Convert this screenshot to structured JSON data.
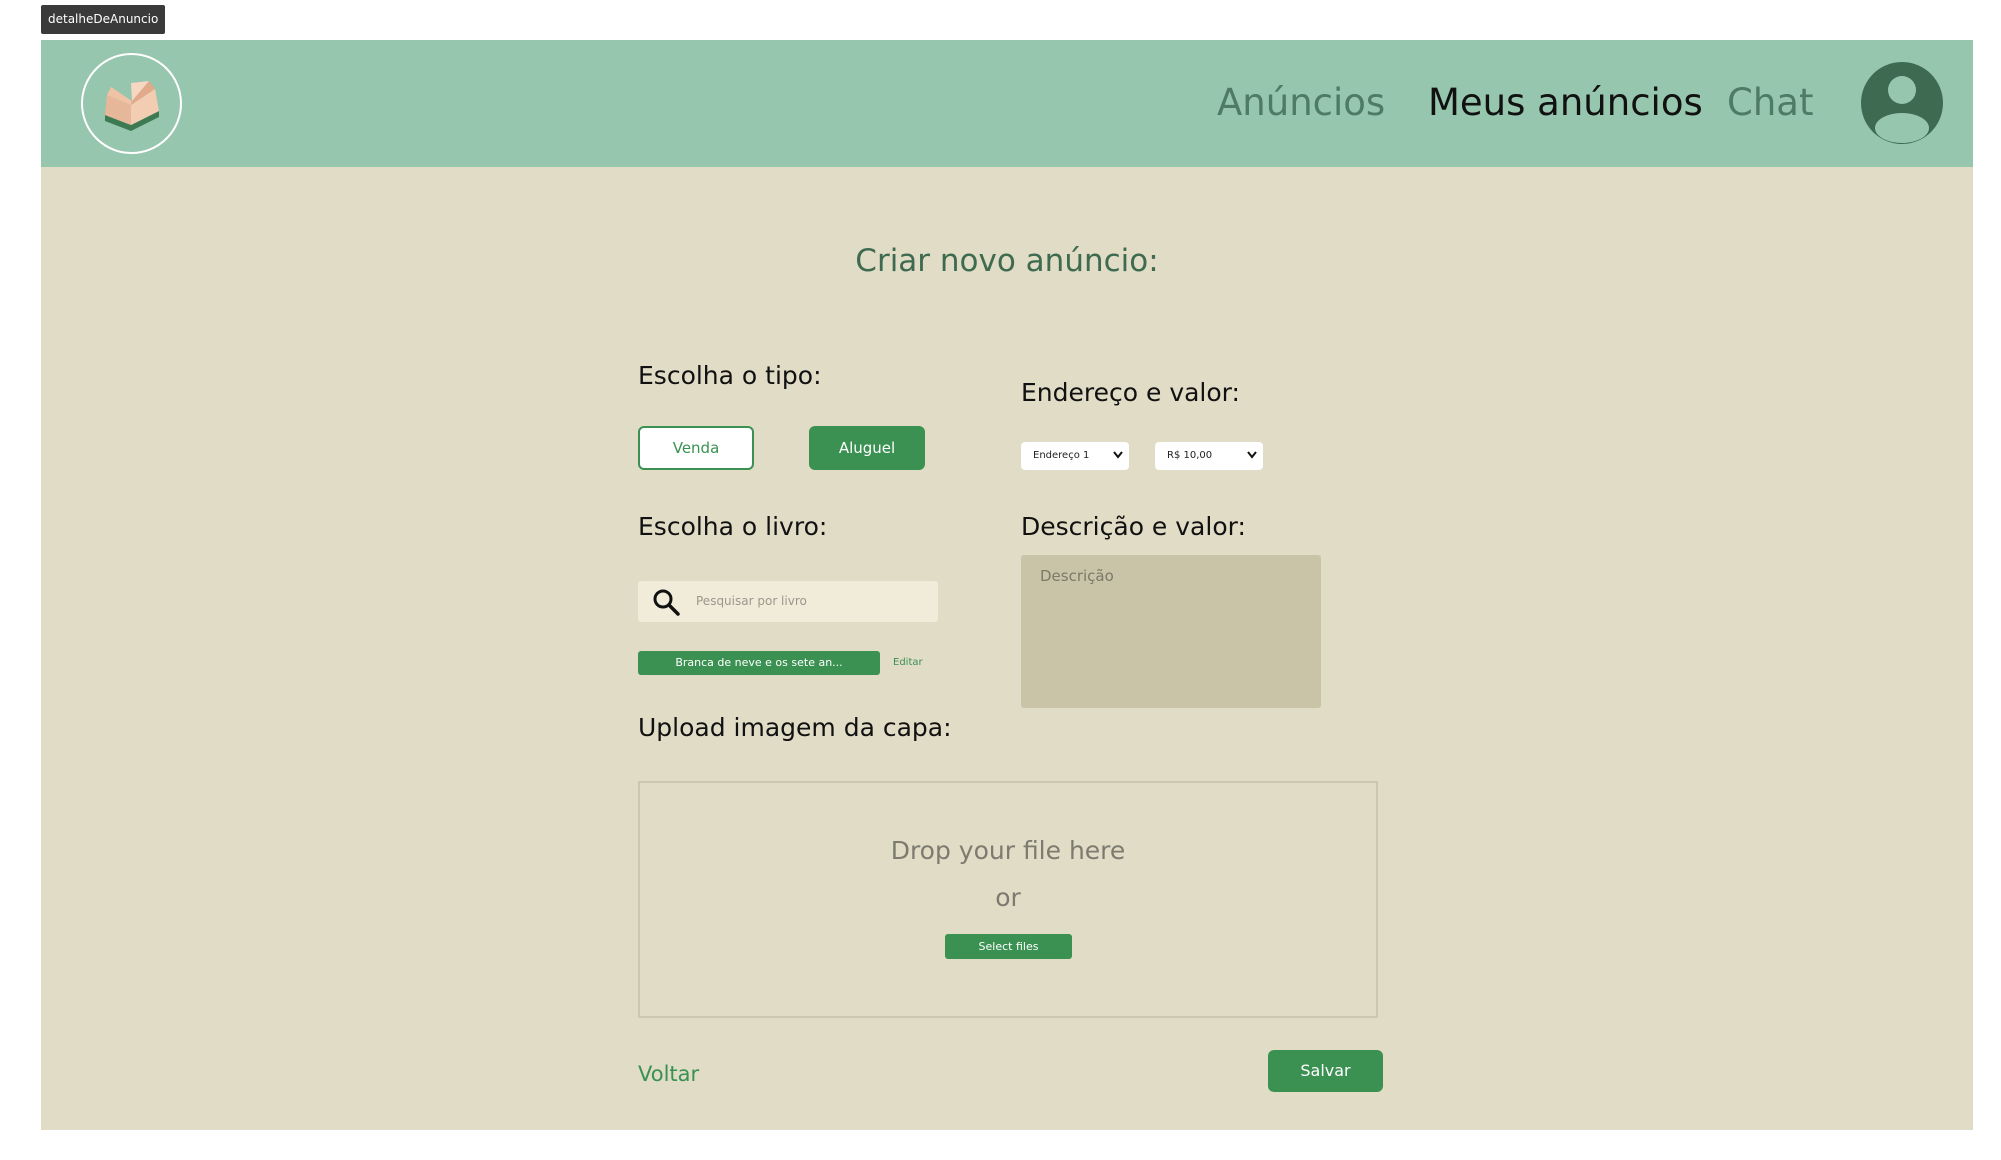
{
  "frame_label": "detalheDeAnuncio",
  "header": {
    "nav": [
      {
        "label": "Anúncios"
      },
      {
        "label": "Meus anúncios"
      },
      {
        "label": "Chat"
      }
    ],
    "active_nav": "Meus anúncios"
  },
  "page_title": "Criar novo anúncio:",
  "tipo": {
    "label": "Escolha o tipo:",
    "options": [
      "Venda",
      "Aluguel"
    ],
    "selected": "Aluguel"
  },
  "endereco": {
    "label": "Endereço e valor:",
    "address_value": "Endereço 1",
    "price_value": "R$ 10,00"
  },
  "livro": {
    "label": "Escolha o livro:",
    "search_placeholder": "Pesquisar por livro",
    "selected_book": "Branca de neve e os sete an...",
    "edit_label": "Editar"
  },
  "descricao": {
    "label": "Descrição e valor:",
    "placeholder": "Descrição"
  },
  "upload": {
    "label": "Upload imagem da capa:",
    "drop_text": "Drop your file here",
    "or_text": "or",
    "select_label": "Select files"
  },
  "footer": {
    "back_label": "Voltar",
    "save_label": "Salvar"
  },
  "colors": {
    "header_bg": "#97c6ae",
    "page_bg": "#e0dcc6",
    "accent": "#3a9152",
    "avatar": "#3d6a50"
  }
}
